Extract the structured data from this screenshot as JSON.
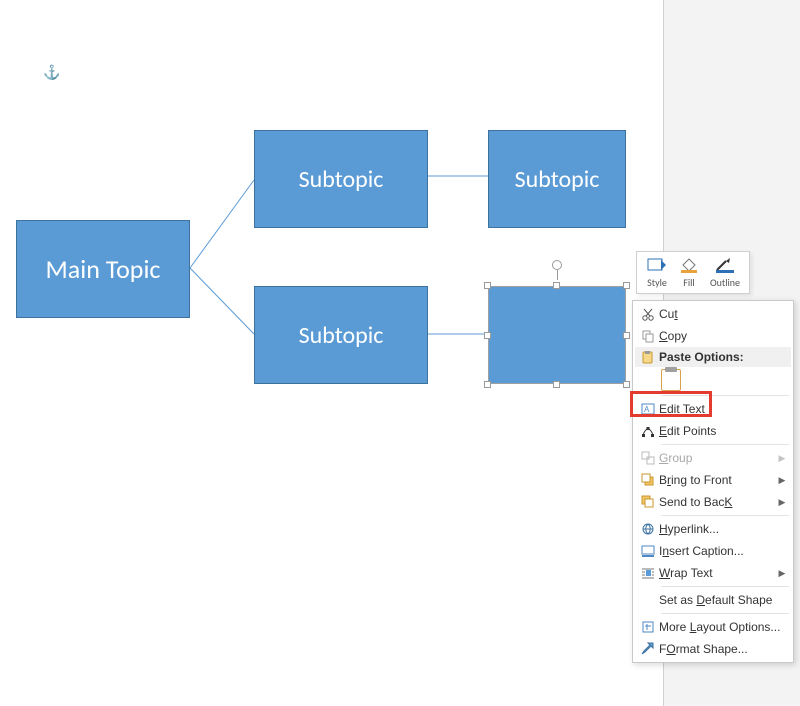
{
  "anchor_glyph": "⚓",
  "shapes": {
    "main": {
      "label": "Main Topic"
    },
    "sub1": {
      "label": "Subtopic"
    },
    "sub2": {
      "label": "Subtopic"
    },
    "sub3": {
      "label": "Subtopic"
    },
    "sub4": {
      "label": ""
    }
  },
  "mini_toolbar": {
    "style": "Style",
    "fill": "Fill",
    "outline": "Outline"
  },
  "context_menu": {
    "cut": "Cut",
    "copy": "Copy",
    "paste_options": "Paste Options:",
    "edit_text": "Edit Text",
    "edit_points": "Edit Points",
    "group": "Group",
    "bring_to_front": "Bring to Front",
    "send_to_back": "Send to Back",
    "hyperlink": "Hyperlink...",
    "insert_caption": "Insert Caption...",
    "wrap_text": "Wrap Text",
    "set_default_shape": "Set as Default Shape",
    "more_layout_options": "More Layout Options...",
    "format_shape": "Format Shape..."
  },
  "accesskeys": {
    "cut": "t",
    "copy": "C",
    "edit_text": "x",
    "edit_points": "E",
    "group": "G",
    "bring_to_front": "r",
    "send_to_back": "K",
    "hyperlink": "H",
    "insert_caption": "n",
    "wrap_text": "W",
    "set_default_shape": "D",
    "more_layout_options": "L",
    "format_shape": "O"
  },
  "colors": {
    "shape_fill": "#5b9bd5",
    "shape_border": "#3d729f",
    "highlight": "#e33b2e"
  }
}
